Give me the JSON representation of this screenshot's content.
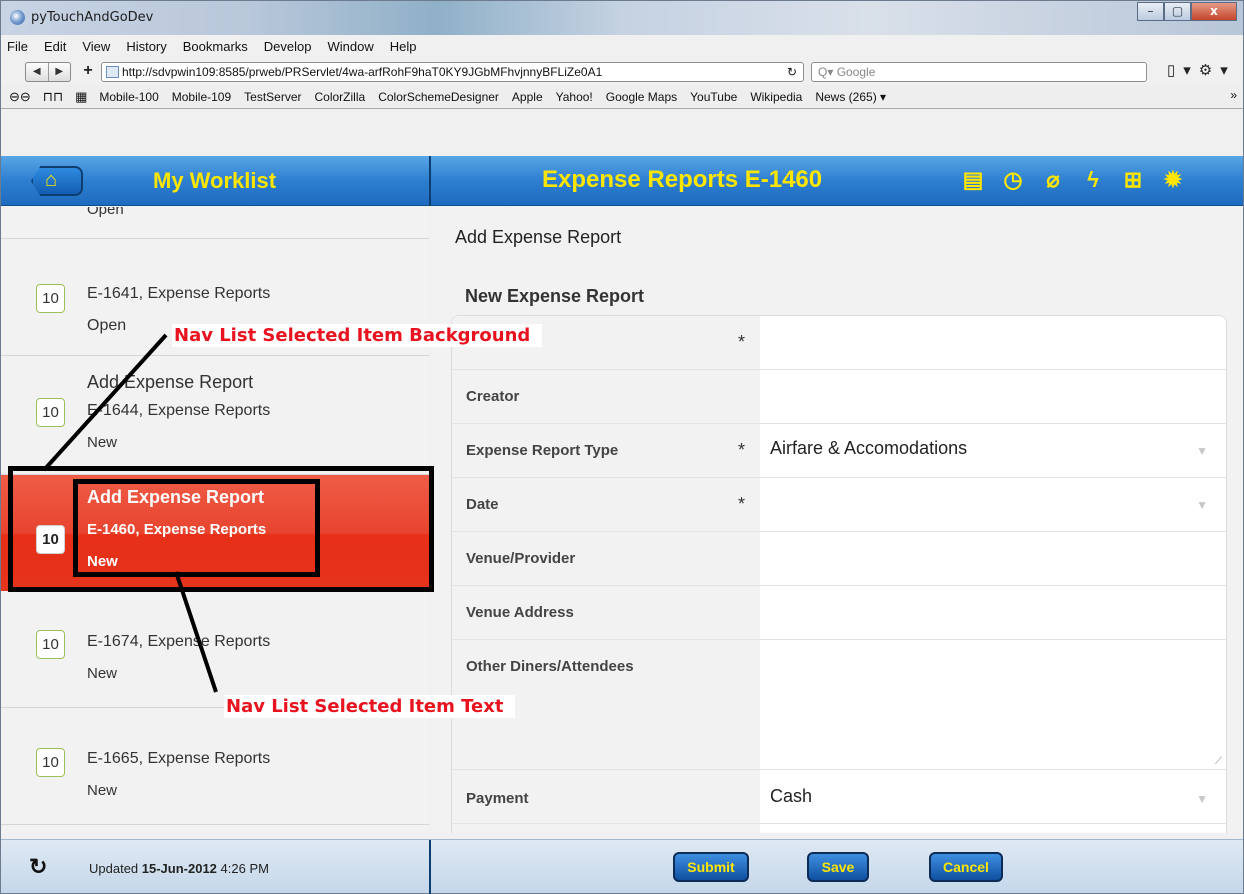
{
  "window": {
    "title": "pyTouchAndGoDev",
    "buttons": [
      "–",
      "▢",
      "x"
    ]
  },
  "menu": [
    "File",
    "Edit",
    "View",
    "History",
    "Bookmarks",
    "Develop",
    "Window",
    "Help"
  ],
  "address": {
    "url": "http://sdvpwin109:8585/prweb/PRServlet/4wa-arfRohF9haT0KY9JGbMFhvjnnyBFLiZe0A1",
    "search_placeholder": "Q▾ Google"
  },
  "bookmarks": [
    "Mobile-100",
    "Mobile-109",
    "TestServer",
    "ColorZilla",
    "ColorSchemeDesigner",
    "Apple",
    "Yahoo!",
    "Google Maps",
    "YouTube",
    "Wikipedia",
    "News (265) ▾"
  ],
  "header": {
    "left_title": "My Worklist",
    "right_title": "Expense Reports E-1460",
    "icons": [
      "document-icon",
      "history-icon",
      "attachment-icon",
      "flash-icon",
      "new-doc-icon",
      "gear-icon"
    ]
  },
  "navlist": {
    "items": [
      {
        "badge": "",
        "line1": "Open",
        "line2": "",
        "line3": ""
      },
      {
        "badge": "10",
        "line1": "E-1641, Expense Reports",
        "line2": "Open",
        "line3": ""
      },
      {
        "badge": "10",
        "line1": "Add Expense Report",
        "line2": "E-1644, Expense Reports",
        "line3": "New"
      },
      {
        "badge": "10",
        "line1": "Add Expense Report",
        "line2": "E-1460, Expense Reports",
        "line3": "New"
      },
      {
        "badge": "10",
        "line1": "E-1674, Expense Reports",
        "line2": "New",
        "line3": ""
      },
      {
        "badge": "10",
        "line1": "E-1665, Expense Reports",
        "line2": "New",
        "line3": ""
      }
    ]
  },
  "form": {
    "section_title": "Add Expense Report",
    "subtitle": "New Expense Report",
    "rows": [
      {
        "label": "",
        "required": "*",
        "value": ""
      },
      {
        "label": "Creator",
        "required": "",
        "value": ""
      },
      {
        "label": "Expense Report Type",
        "required": "*",
        "value": "Airfare & Accomodations"
      },
      {
        "label": "Date",
        "required": "*",
        "value": ""
      },
      {
        "label": "Venue/Provider",
        "required": "",
        "value": ""
      },
      {
        "label": "Venue Address",
        "required": "",
        "value": ""
      },
      {
        "label": "Other Diners/Attendees",
        "required": "",
        "value": ""
      },
      {
        "label": "Payment",
        "required": "",
        "value": "Cash"
      }
    ]
  },
  "footer": {
    "updated_prefix": "Updated ",
    "updated_date": "15-Jun-2012",
    "updated_time": " 4:26 PM",
    "submit": "Submit",
    "save": "Save",
    "cancel": "Cancel"
  },
  "annotations": {
    "background": "Nav List Selected Item Background",
    "text": "Nav List Selected Item Text"
  },
  "colors": {
    "header_title": "#ffe600",
    "selected_item": "#e8442f",
    "annotation": "#e8131f"
  }
}
